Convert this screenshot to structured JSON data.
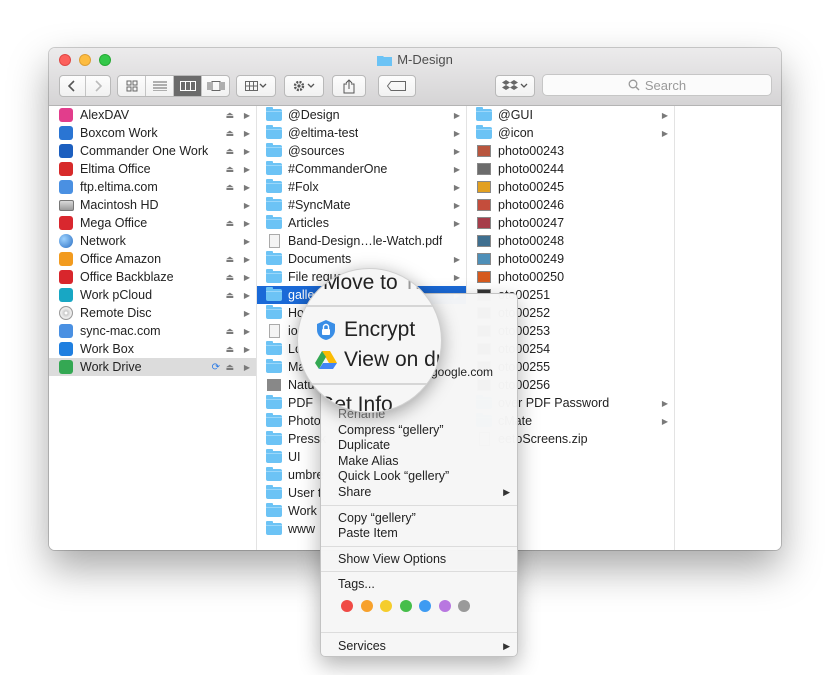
{
  "window": {
    "title": "M-Design"
  },
  "toolbar": {
    "back_icon": "chevron-left-icon",
    "forward_icon": "chevron-right-icon",
    "view_modes": [
      "icon-view-icon",
      "list-view-icon",
      "column-view-icon",
      "coverflow-view-icon"
    ],
    "active_view_mode": "column-view-icon",
    "arrange_icon": "arrange-icon",
    "action_icon": "gear-icon",
    "share_icon": "share-icon",
    "tag_icon": "tag-icon",
    "dropbox_icon": "dropbox-icon",
    "search_placeholder": "Search"
  },
  "columns": {
    "locations": [
      {
        "label": "AlexDAV",
        "icon": "webdav-icon",
        "color": "#e23d8c",
        "eject": true,
        "arrow": true
      },
      {
        "label": "Boxcom Work",
        "icon": "box-icon",
        "color": "#2a75d3",
        "eject": true,
        "arrow": true
      },
      {
        "label": "Commander One Work",
        "icon": "commander-one-icon",
        "color": "#1c5fbf",
        "eject": true,
        "arrow": true
      },
      {
        "label": "Eltima Office",
        "icon": "eltima-icon",
        "color": "#d72a2a",
        "eject": true,
        "arrow": true
      },
      {
        "label": "ftp.eltima.com",
        "icon": "ftp-icon",
        "color": "#4a90e2",
        "eject": true,
        "arrow": true
      },
      {
        "label": "Macintosh HD",
        "icon": "hard-disk-icon",
        "color": "#888888",
        "eject": false,
        "arrow": true
      },
      {
        "label": "Mega Office",
        "icon": "mega-icon",
        "color": "#d9272e",
        "eject": true,
        "arrow": true
      },
      {
        "label": "Network",
        "icon": "network-icon",
        "color": "#2b6fc2",
        "eject": false,
        "arrow": true
      },
      {
        "label": "Office Amazon",
        "icon": "amazon-icon",
        "color": "#f29b1f",
        "eject": true,
        "arrow": true
      },
      {
        "label": "Office Backblaze",
        "icon": "backblaze-icon",
        "color": "#d8262c",
        "eject": true,
        "arrow": true
      },
      {
        "label": "Work pCloud",
        "icon": "pcloud-icon",
        "color": "#18a7c4",
        "eject": true,
        "arrow": true
      },
      {
        "label": "Remote Disc",
        "icon": "cd-icon",
        "color": "#bbbbbb",
        "eject": false,
        "arrow": true
      },
      {
        "label": "sync-mac.com",
        "icon": "ftp-icon",
        "color": "#4a90e2",
        "eject": true,
        "arrow": true
      },
      {
        "label": "Work Box",
        "icon": "dropbox-icon",
        "color": "#1f7fe0",
        "eject": true,
        "arrow": true
      },
      {
        "label": "Work Drive",
        "icon": "google-drive-icon",
        "color": "#34a853",
        "eject": true,
        "arrow": true,
        "sync": true,
        "selected": true
      }
    ],
    "mdesign": [
      {
        "label": "@Design",
        "type": "folder",
        "arrow": true
      },
      {
        "label": "@eltima-test",
        "type": "folder",
        "arrow": true
      },
      {
        "label": "@sources",
        "type": "folder",
        "arrow": true
      },
      {
        "label": "#CommanderOne",
        "type": "folder",
        "arrow": true
      },
      {
        "label": "#Folx",
        "type": "folder",
        "arrow": true
      },
      {
        "label": "#SyncMate",
        "type": "folder",
        "arrow": true
      },
      {
        "label": "Articles",
        "type": "folder",
        "arrow": true
      },
      {
        "label": "Band-Design…le-Watch.pdf",
        "type": "pdf",
        "arrow": false
      },
      {
        "label": "Documents",
        "type": "folder",
        "arrow": true
      },
      {
        "label": "File reque",
        "type": "folder",
        "arrow": true
      },
      {
        "label": "galle",
        "type": "folder",
        "arrow": true,
        "selected": true
      },
      {
        "label": "Ho",
        "type": "folder",
        "arrow": false
      },
      {
        "label": "io",
        "type": "pdf",
        "arrow": false
      },
      {
        "label": "Lo",
        "type": "folder",
        "arrow": false
      },
      {
        "label": "Ma",
        "type": "folder",
        "arrow": false
      },
      {
        "label": "Natu",
        "type": "image",
        "arrow": false
      },
      {
        "label": "PDF",
        "type": "folder",
        "arrow": false
      },
      {
        "label": "Photo",
        "type": "folder",
        "arrow": false
      },
      {
        "label": "Pressk",
        "type": "folder",
        "arrow": false
      },
      {
        "label": "UI",
        "type": "folder",
        "arrow": false
      },
      {
        "label": "umbre",
        "type": "folder",
        "arrow": false
      },
      {
        "label": "User t",
        "type": "folder",
        "arrow": false
      },
      {
        "label": "Work",
        "type": "folder",
        "arrow": false
      },
      {
        "label": "www",
        "type": "folder",
        "arrow": false
      }
    ],
    "gallery": [
      {
        "label": "@GUI",
        "type": "folder",
        "arrow": true
      },
      {
        "label": "@icon",
        "type": "folder",
        "arrow": true
      },
      {
        "label": "photo00243",
        "type": "image",
        "color": "#b8563e"
      },
      {
        "label": "photo00244",
        "type": "image",
        "color": "#6b6b6b"
      },
      {
        "label": "photo00245",
        "type": "image",
        "color": "#e2a020"
      },
      {
        "label": "photo00246",
        "type": "image",
        "color": "#c44d3c"
      },
      {
        "label": "photo00247",
        "type": "image",
        "color": "#a63d4a"
      },
      {
        "label": "photo00248",
        "type": "image",
        "color": "#3f6f8f"
      },
      {
        "label": "photo00249",
        "type": "image",
        "color": "#4e8fb8"
      },
      {
        "label": "photo00250",
        "type": "image",
        "color": "#d65a1e"
      },
      {
        "label": "oto00251",
        "type": "image",
        "color": "#333333"
      },
      {
        "label": "oto00252",
        "type": "image",
        "color": "#333333"
      },
      {
        "label": "oto00253",
        "type": "image",
        "color": "#333333"
      },
      {
        "label": "oto00254",
        "type": "image",
        "color": "#333333"
      },
      {
        "label": "oto00255",
        "type": "image",
        "color": "#333333"
      },
      {
        "label": "oto00256",
        "type": "image",
        "color": "#333333"
      },
      {
        "label": "over PDF Password",
        "type": "folder",
        "arrow": true
      },
      {
        "label": "cMate",
        "type": "folder",
        "arrow": true
      },
      {
        "label": "eetoScreens.zip",
        "type": "zip",
        "arrow": false
      }
    ]
  },
  "context_menu": {
    "rename": "Rename",
    "compress": "Compress “gellery”",
    "duplicate": "Duplicate",
    "make_alias": "Make Alias",
    "quick_look": "Quick Look “gellery”",
    "share": "Share",
    "copy": "Copy “gellery”",
    "paste": "Paste Item",
    "show_view_options": "Show View Options",
    "tags": "Tags...",
    "tag_colors": [
      "#f04a45",
      "#f7a12c",
      "#f5cd2c",
      "#46be4a",
      "#3e9bf2",
      "#b877e0",
      "#9a9a9a"
    ],
    "services": "Services",
    "partial_google": "google.com"
  },
  "magnifier": {
    "move_to": "Move to",
    "move_to_tail": "Tr",
    "encrypt": "Encrypt",
    "encrypt_icon": "encrypt-icon",
    "view_on": "View on dr",
    "view_on_icon": "google-drive-icon",
    "get_info": "Get Info"
  }
}
